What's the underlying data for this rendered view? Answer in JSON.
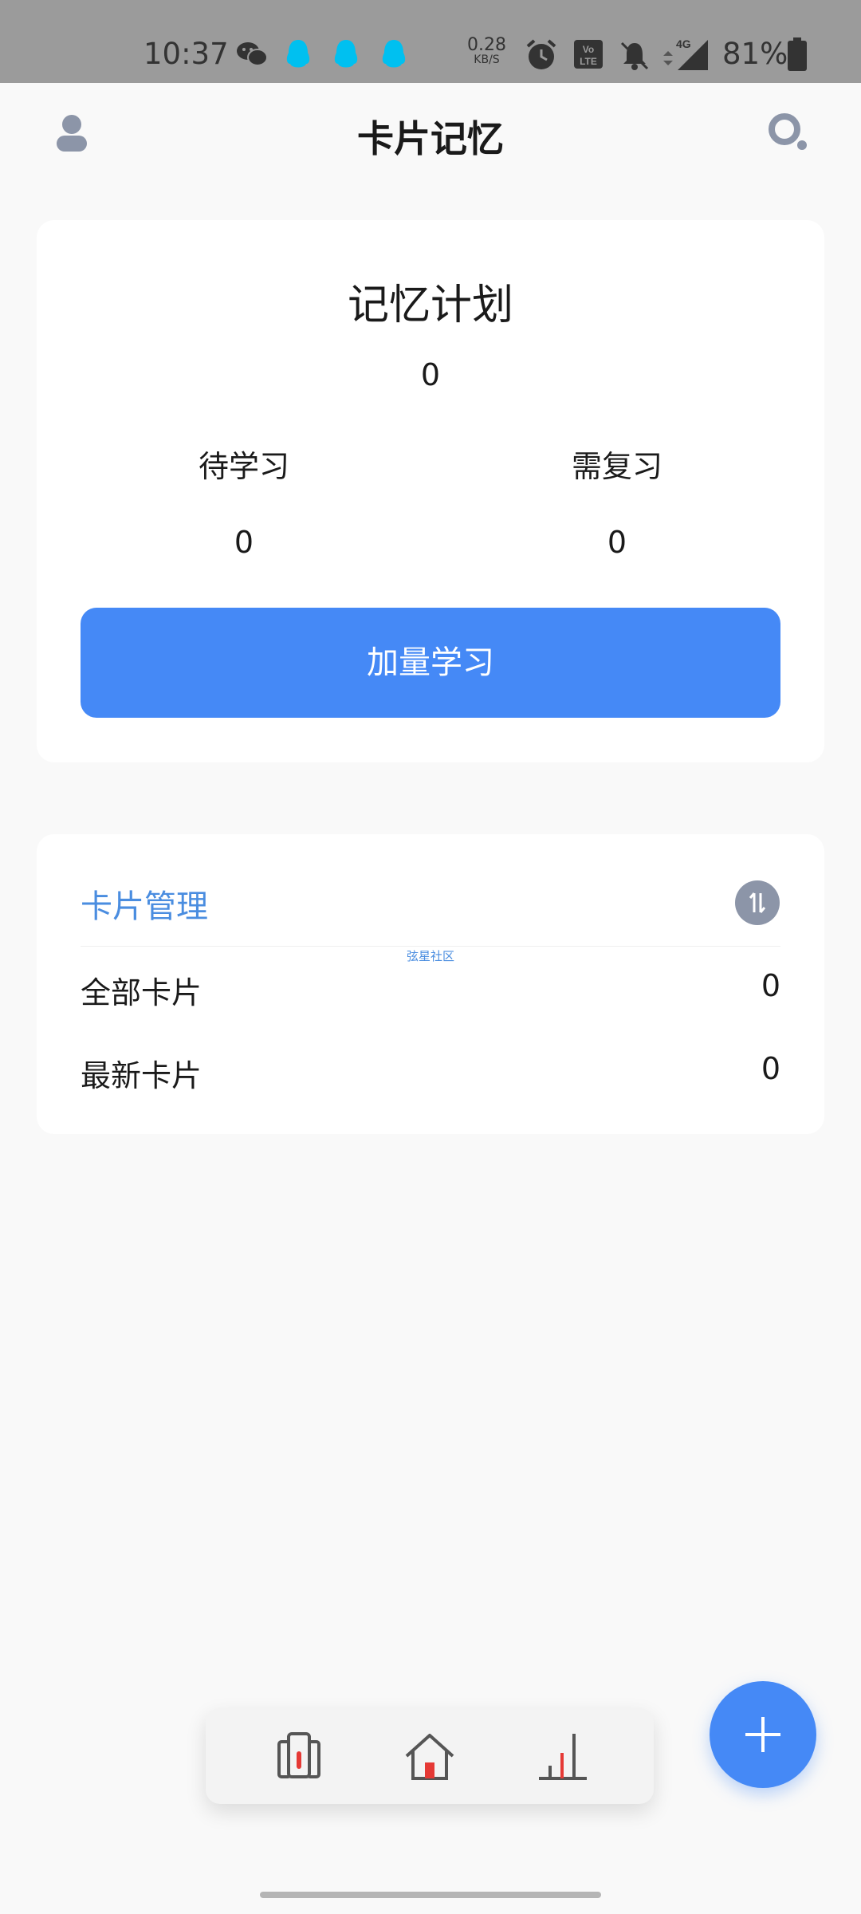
{
  "status_bar": {
    "time": "10:37",
    "net_speed_value": "0.28",
    "net_speed_unit": "KB/S",
    "battery": "81%",
    "icons": [
      "wechat-icon",
      "qq-icon",
      "qq-icon",
      "qq-icon",
      "alarm-icon",
      "volte-icon",
      "mute-icon",
      "signal-4g-icon",
      "battery-icon"
    ]
  },
  "header": {
    "title": "卡片记忆",
    "left_icon": "avatar-icon",
    "right_icon": "search-icon"
  },
  "plan": {
    "title": "记忆计划",
    "total": "0",
    "pending_label": "待学习",
    "pending_value": "0",
    "review_label": "需复习",
    "review_value": "0",
    "button_label": "加量学习"
  },
  "manage": {
    "title": "卡片管理",
    "watermark": "弦星社区",
    "rows": [
      {
        "label": "全部卡片",
        "value": "0"
      },
      {
        "label": "最新卡片",
        "value": "0"
      }
    ]
  },
  "bottom_nav": {
    "items": [
      "cards-icon",
      "home-icon",
      "stats-icon"
    ]
  },
  "fab_icon": "plus-icon",
  "colors": {
    "accent": "#4589f6",
    "link": "#4a8de0",
    "status_bar": "#9b9b9b",
    "nav_red": "#e53935"
  }
}
